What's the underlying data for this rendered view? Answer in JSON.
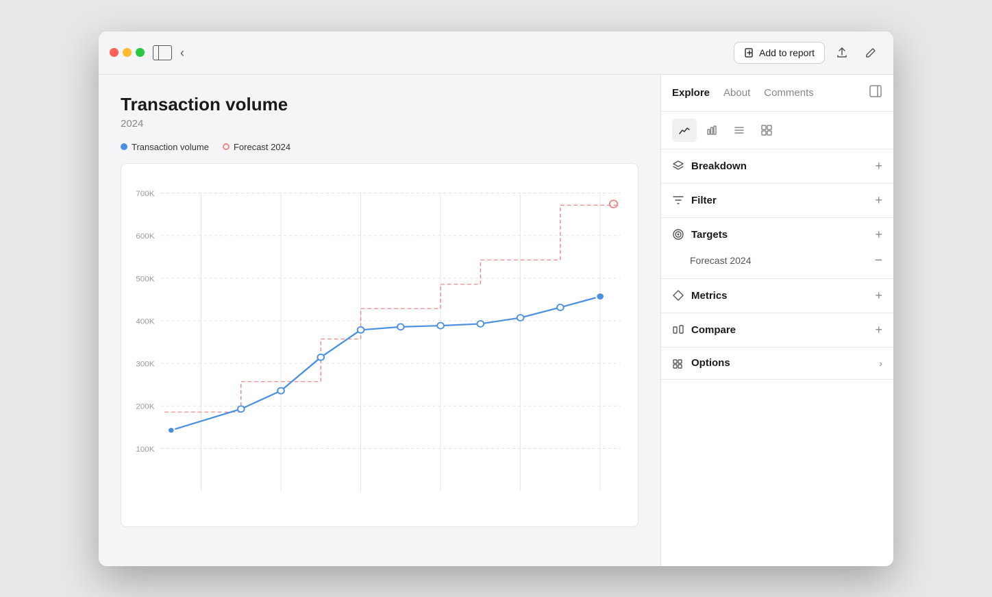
{
  "window": {
    "title": "Transaction volume"
  },
  "titlebar": {
    "sidebar_icon": "sidebar-icon",
    "back_label": "‹",
    "add_report_label": "Add to report",
    "share_icon": "share-icon",
    "edit_icon": "edit-icon"
  },
  "chart": {
    "title": "Transaction volume",
    "subtitle": "2024",
    "legend": [
      {
        "type": "solid",
        "color": "#4a90e2",
        "label": "Transaction volume"
      },
      {
        "type": "outline",
        "color": "#e88",
        "label": "Forecast 2024"
      }
    ],
    "y_labels": [
      "700K",
      "600K",
      "500K",
      "400K",
      "300K",
      "200K",
      "100K"
    ]
  },
  "right_panel": {
    "tabs": [
      {
        "label": "Explore",
        "active": true
      },
      {
        "label": "About",
        "active": false
      },
      {
        "label": "Comments",
        "active": false
      }
    ],
    "view_types": [
      {
        "name": "line-chart-icon",
        "active": true
      },
      {
        "name": "bar-chart-icon",
        "active": false
      },
      {
        "name": "list-icon",
        "active": false
      },
      {
        "name": "grid-icon",
        "active": false
      }
    ],
    "sections": [
      {
        "name": "breakdown",
        "icon": "layers-icon",
        "label": "Breakdown",
        "action": "plus",
        "expanded": false,
        "children": []
      },
      {
        "name": "filter",
        "icon": "filter-icon",
        "label": "Filter",
        "action": "plus",
        "expanded": false,
        "children": []
      },
      {
        "name": "targets",
        "icon": "target-icon",
        "label": "Targets",
        "action": "plus",
        "expanded": true,
        "children": [
          {
            "label": "Forecast 2024",
            "action": "minus"
          }
        ]
      },
      {
        "name": "metrics",
        "icon": "diamond-icon",
        "label": "Metrics",
        "action": "plus",
        "expanded": false,
        "children": []
      },
      {
        "name": "compare",
        "icon": "compare-icon",
        "label": "Compare",
        "action": "plus",
        "expanded": false,
        "children": []
      },
      {
        "name": "options",
        "icon": "options-icon",
        "label": "Options",
        "action": "arrow",
        "expanded": false,
        "children": []
      }
    ]
  }
}
